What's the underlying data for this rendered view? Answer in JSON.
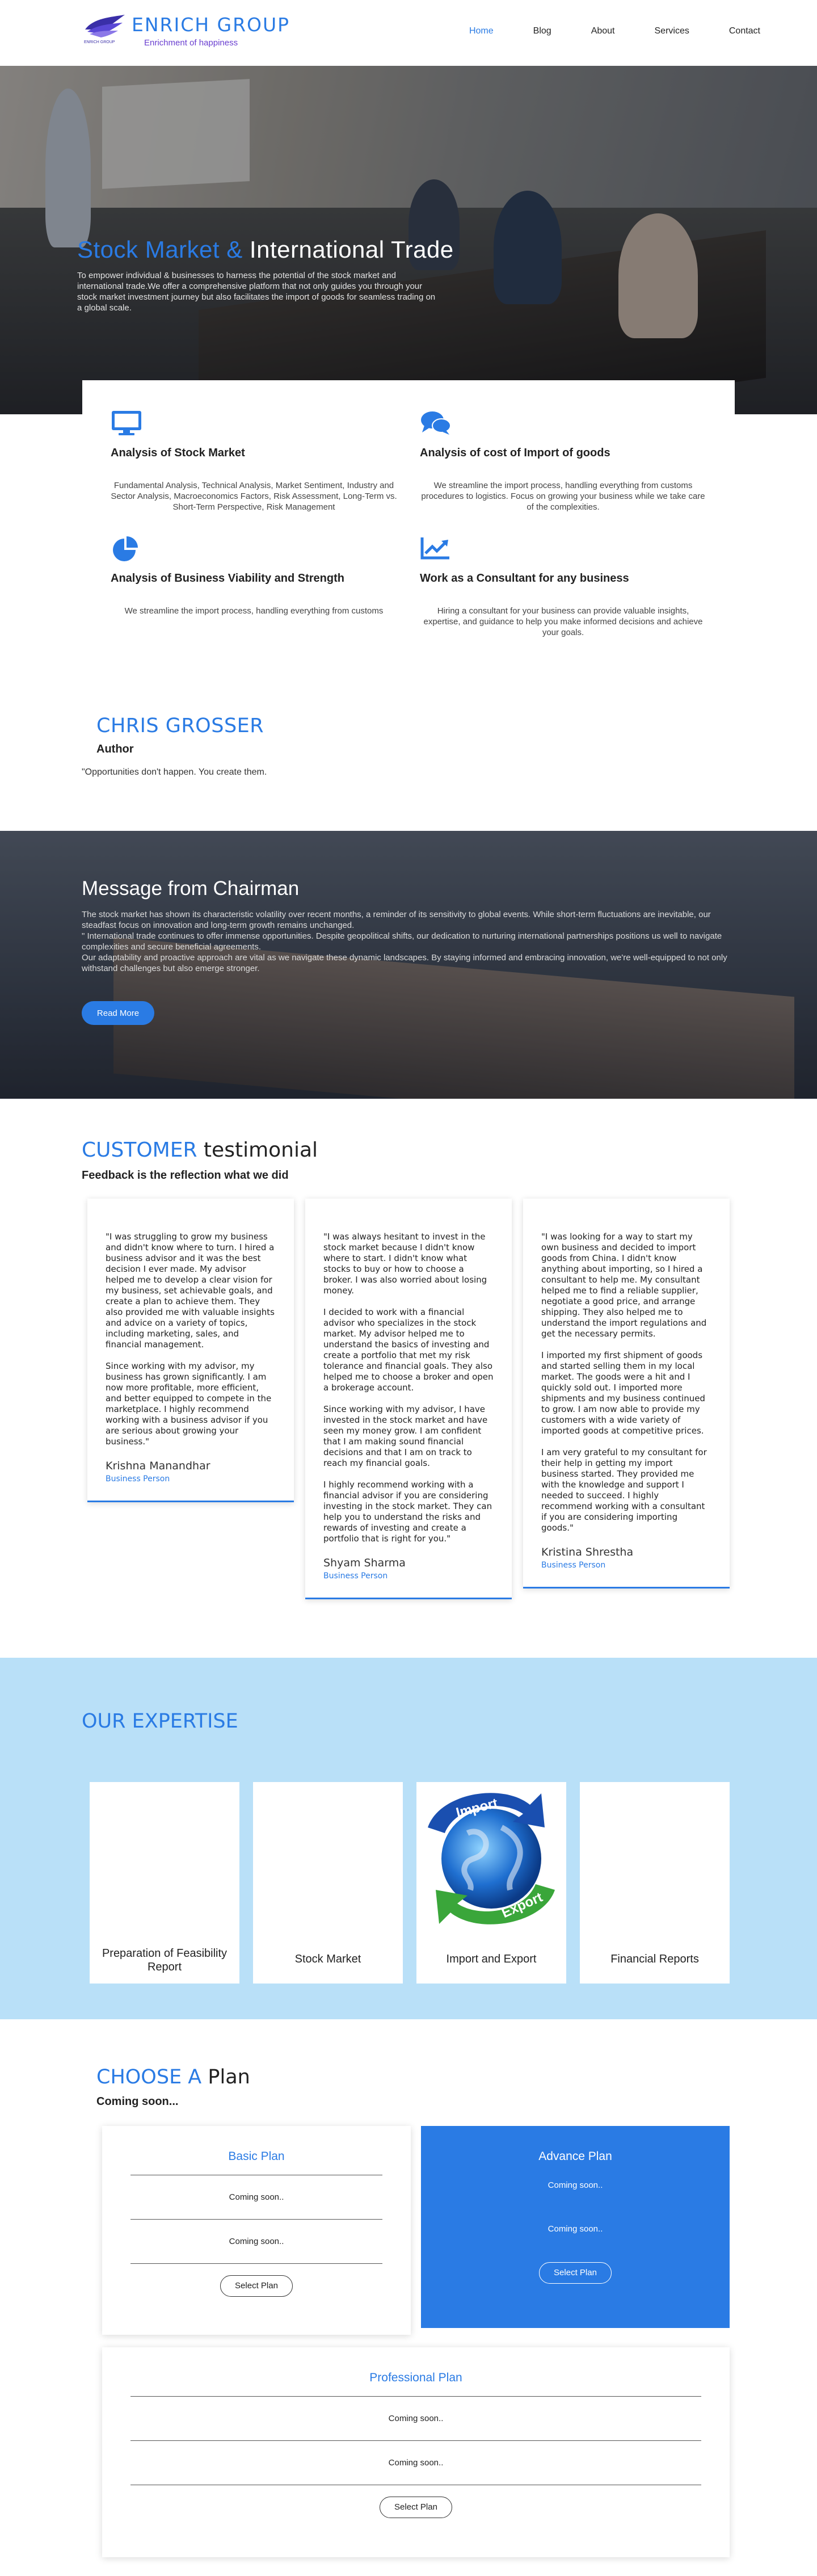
{
  "brand": {
    "name": "ENRICH GROUP",
    "tagline": "Enrichment of happiness",
    "logo_mini": "ENRICH GROUP"
  },
  "nav": [
    {
      "label": "Home",
      "active": true
    },
    {
      "label": "Blog"
    },
    {
      "label": "About"
    },
    {
      "label": "Services"
    },
    {
      "label": "Contact"
    }
  ],
  "hero": {
    "title_accent": "Stock Market &",
    "title_rest": " International Trade",
    "text": "To empower individual & businesses to harness the potential of the stock market and international trade.We offer a comprehensive platform that not only guides you through your stock market investment journey but also facilitates the import of goods for seamless trading on a global scale."
  },
  "services": [
    {
      "icon": "monitor-icon",
      "title": "Analysis of Stock Market",
      "text": "Fundamental Analysis, Technical Analysis, Market Sentiment, Industry and Sector Analysis, Macroeconomics Factors, Risk Assessment, Long-Term vs. Short-Term Perspective, Risk Management"
    },
    {
      "icon": "chat-bubbles-icon",
      "title": "Analysis of cost of Import of goods",
      "text": "We streamline the import process, handling everything from customs procedures to logistics. Focus on growing your business while we take care of the complexities."
    },
    {
      "icon": "pie-chart-icon",
      "title": "Analysis of Business Viability and Strength",
      "text": "We streamline the import process, handling everything from customs"
    },
    {
      "icon": "trend-chart-icon",
      "title": "Work as a Consultant for any business",
      "text": "Hiring a consultant for your business can provide valuable insights, expertise, and guidance to help you make informed decisions and achieve your goals."
    }
  ],
  "author": {
    "name": "CHRIS GROSSER",
    "role": "Author",
    "quote": "\"Opportunities don't happen. You create them."
  },
  "chairman": {
    "title": "Message from Chairman",
    "text": "The stock market has shown its characteristic volatility over recent months, a reminder of its sensitivity to global events. While short-term fluctuations are inevitable, our steadfast focus on innovation and long-term growth remains unchanged.\n\" International trade continues to offer immense opportunities. Despite geopolitical shifts, our dedication to nurturing international partnerships positions us well to navigate complexities and secure beneficial agreements.\nOur adaptability and proactive approach are vital as we navigate these dynamic landscapes. By staying informed and embracing innovation, we're well-equipped to not only withstand challenges but also emerge stronger.",
    "button": "Read More"
  },
  "testimonials": {
    "title_accent": "CUSTOMER",
    "title_rest": " testimonial",
    "subtitle": "Feedback is the reflection what we did",
    "items": [
      {
        "quote": "\"I was struggling to grow my business and didn't know where to turn. I hired a business advisor and it was the best decision I ever made. My advisor helped me to develop a clear vision for my business, set achievable goals, and create a plan to achieve them. They also provided me with valuable insights and advice on a variety of topics, including marketing, sales, and financial management.\n\nSince working with my advisor, my business has grown significantly. I am now more profitable, more efficient, and better equipped to compete in the marketplace. I highly recommend working with a business advisor if you are serious about growing your business.\"",
        "name": "Krishna Manandhar",
        "role": "Business Person"
      },
      {
        "quote": "\"I was always hesitant to invest in the stock market because I didn't know where to start. I didn't know what stocks to buy or how to choose a broker. I was also worried about losing money.\n\nI decided to work with a financial advisor who specializes in the stock market. My advisor helped me to understand the basics of investing and create a portfolio that met my risk tolerance and financial goals. They also helped me to choose a broker and open a brokerage account.\n\nSince working with my advisor, I have invested in the stock market and have seen my money grow. I am confident that I am making sound financial decisions and that I am on track to reach my financial goals.\n\nI highly recommend working with a financial advisor if you are considering investing in the stock market. They can help you to understand the risks and rewards of investing and create a portfolio that is right for you.\"",
        "name": "Shyam Sharma",
        "role": "Business Person"
      },
      {
        "quote": "\"I was looking for a way to start my own business and decided to import goods from China. I didn't know anything about importing, so I hired a consultant to help me. My consultant helped me to find a reliable supplier, negotiate a good price, and arrange shipping. They also helped me to understand the import regulations and get the necessary permits.\n\nI imported my first shipment of goods and started selling them in my local market. The goods were a hit and I quickly sold out. I imported more shipments and my business continued to grow. I am now able to provide my customers with a wide variety of imported goods at competitive prices.\n\nI am very grateful to my consultant for their help in getting my import business started. They provided me with the knowledge and support I needed to succeed. I highly recommend working with a consultant if you are considering importing goods.\"",
        "name": "Kristina Shrestha",
        "role": "Business Person"
      }
    ]
  },
  "expertise": {
    "title": "OUR EXPERTISE",
    "items": [
      {
        "label": "Preparation of Feasibility Report"
      },
      {
        "label": "Stock Market"
      },
      {
        "label": "Import and Export",
        "image_text_top": "Import",
        "image_text_bottom": "Export"
      },
      {
        "label": "Financial Reports"
      }
    ]
  },
  "plans": {
    "title_accent": "CHOOSE A",
    "title_rest": " Plan",
    "subtitle": "Coming soon...",
    "basic": {
      "title": "Basic Plan",
      "line1": "Coming soon..",
      "line2": "Coming soon..",
      "button": "Select Plan"
    },
    "advance": {
      "title": "Advance Plan",
      "line1": "Coming soon..",
      "line2": "Coming soon..",
      "button": "Select Plan"
    },
    "pro": {
      "title": "Professional Plan",
      "line1": "Coming soon..",
      "line2": "Coming soon..",
      "button": "Select Plan"
    }
  }
}
